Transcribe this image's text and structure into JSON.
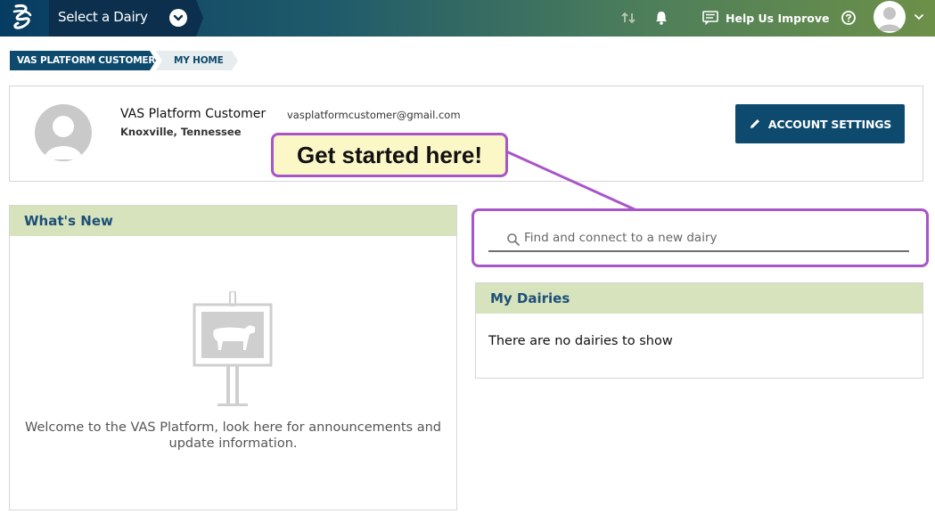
{
  "topbar": {
    "dairy_select_label": "Select a Dairy",
    "help_label": "Help Us Improve",
    "icons": [
      "logo-icon",
      "sync-icon",
      "bell-icon",
      "feedback-icon",
      "help-icon",
      "avatar",
      "chevron-down-icon"
    ]
  },
  "breadcrumb": {
    "items": [
      {
        "label": "VAS PLATFORM CUSTOMER"
      },
      {
        "label": "MY HOME"
      }
    ]
  },
  "profile": {
    "name": "VAS Platform Customer",
    "location": "Knoxville, Tennessee",
    "email": "vasplatformcustomer@gmail.com",
    "account_settings_label": "ACCOUNT SETTINGS"
  },
  "callout": {
    "text": "Get started here!"
  },
  "whats_new": {
    "title": "What's New",
    "message": "Welcome to the VAS Platform, look here for announcements and update information."
  },
  "search": {
    "placeholder": "Find and connect to a new dairy",
    "value": ""
  },
  "my_dairies": {
    "title": "My Dairies",
    "empty_message": "There are no dairies to show"
  },
  "colors": {
    "brand_dark": "#0d4a6e",
    "panel_header": "#d6e3bd",
    "callout_border": "#a855c9",
    "callout_fill": "#fcf7c6"
  }
}
